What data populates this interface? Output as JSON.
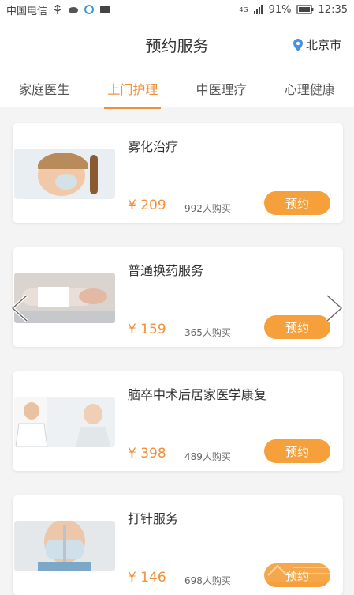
{
  "status": {
    "carrier": "中国电信",
    "network": "4G",
    "battery": "91%",
    "time": "12:35"
  },
  "header": {
    "title": "预约服务",
    "location": "北京市"
  },
  "tabs": [
    {
      "label": "家庭医生",
      "active": false
    },
    {
      "label": "上门护理",
      "active": true
    },
    {
      "label": "中医理疗",
      "active": false
    },
    {
      "label": "心理健康",
      "active": false
    }
  ],
  "services": [
    {
      "name": "雾化治疗",
      "price": "¥ 209",
      "sold": "992人购买",
      "button": "预约"
    },
    {
      "name": "普通换药服务",
      "price": "¥ 159",
      "sold": "365人购买",
      "button": "预约"
    },
    {
      "name": "脑卒中术后居家医学康复",
      "price": "¥ 398",
      "sold": "489人购买",
      "button": "预约"
    },
    {
      "name": "打针服务",
      "price": "¥ 146",
      "sold": "698人购买",
      "button": "预约"
    }
  ],
  "colors": {
    "accent": "#f0913a",
    "button": "#f5a03b",
    "location_pin": "#4a90e2"
  }
}
